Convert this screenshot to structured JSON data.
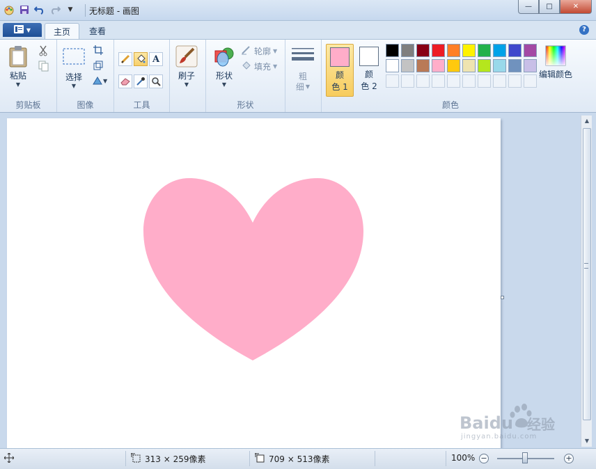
{
  "window": {
    "title": "无标题 - 画图",
    "controls": {
      "minimize": "—",
      "maximize": "□",
      "close": "✕"
    }
  },
  "tabs": [
    {
      "label": "主页",
      "active": true
    },
    {
      "label": "查看",
      "active": false
    }
  ],
  "ribbon": {
    "clipboard": {
      "label": "剪贴板",
      "paste": "粘贴"
    },
    "image": {
      "label": "图像",
      "select": "选择"
    },
    "tools": {
      "label": "工具"
    },
    "brushes": {
      "brush": "刷子"
    },
    "shapes": {
      "label": "形状",
      "shape_btn": "形状",
      "outline": "轮廓",
      "fill": "填充"
    },
    "size": {
      "line1": "粗",
      "line2": "细"
    },
    "colors": {
      "label": "颜色",
      "color1": {
        "line1": "颜",
        "line2": "色 1",
        "value": "#ffadc9"
      },
      "color2": {
        "line1": "颜",
        "line2": "色 2",
        "value": "#ffffff"
      },
      "edit": "编辑颜色",
      "palette_row1": [
        "#000000",
        "#7f7f7f",
        "#880015",
        "#ed1c24",
        "#ff7f27",
        "#fff200",
        "#22b14c",
        "#00a2e8",
        "#3f48cc",
        "#a349a4"
      ],
      "palette_row2": [
        "#ffffff",
        "#c3c3c3",
        "#b97a57",
        "#ffaec9",
        "#ffc90e",
        "#efe4b0",
        "#b5e61d",
        "#99d9ea",
        "#7092be",
        "#c8bfe7"
      ]
    }
  },
  "canvas": {
    "shape_color": "#ffadc9",
    "background": "#ffffff"
  },
  "status": {
    "selection_size": "313 × 259像素",
    "canvas_size": "709 × 513像素",
    "zoom": "100%"
  },
  "watermark": {
    "brand": "Baidu",
    "suffix": "经验",
    "url": "jingyan.baidu.com"
  }
}
